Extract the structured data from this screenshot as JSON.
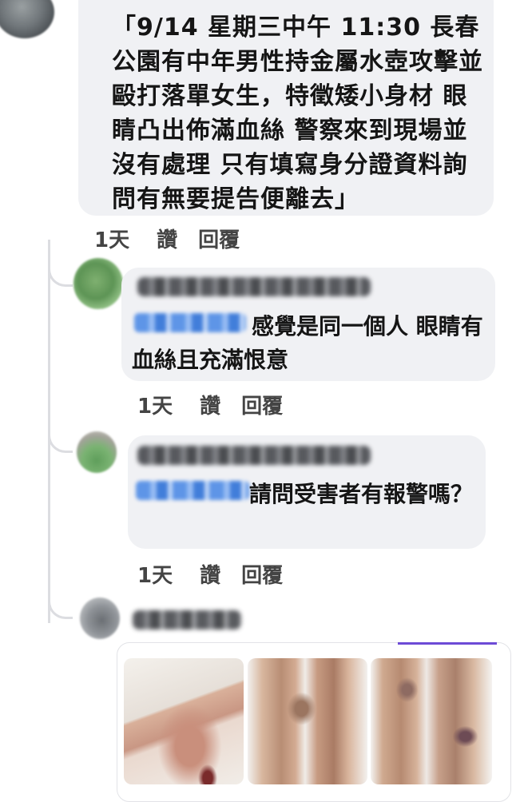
{
  "main_comment": {
    "text": "「9/14 星期三中午 11:30 長春公園有中年男性持金屬水壺攻擊並毆打落單女生，特徵矮小身材 眼睛凸出佈滿血絲 警察來到現場並沒有處理 只有填寫身分證資料詢問有無要提告便離去」",
    "time": "1天",
    "like_label": "讚",
    "reply_label": "回覆"
  },
  "replies": [
    {
      "text": "感覺是同一個人 眼睛有血絲且充滿恨意",
      "time": "1天",
      "like_label": "讚",
      "reply_label": "回覆"
    },
    {
      "text": "請問受害者有報警嗎？",
      "time": "1天",
      "like_label": "讚",
      "reply_label": "回覆"
    }
  ],
  "colors": {
    "bubble": "#f0f1f4",
    "thread_line": "#dcdde1",
    "mention_blue": "#4f8ce6",
    "accent_purple": "#6d4bd6"
  },
  "icons": [
    "avatar",
    "blurred-name",
    "blurred-mention",
    "photo-thumbnail"
  ]
}
